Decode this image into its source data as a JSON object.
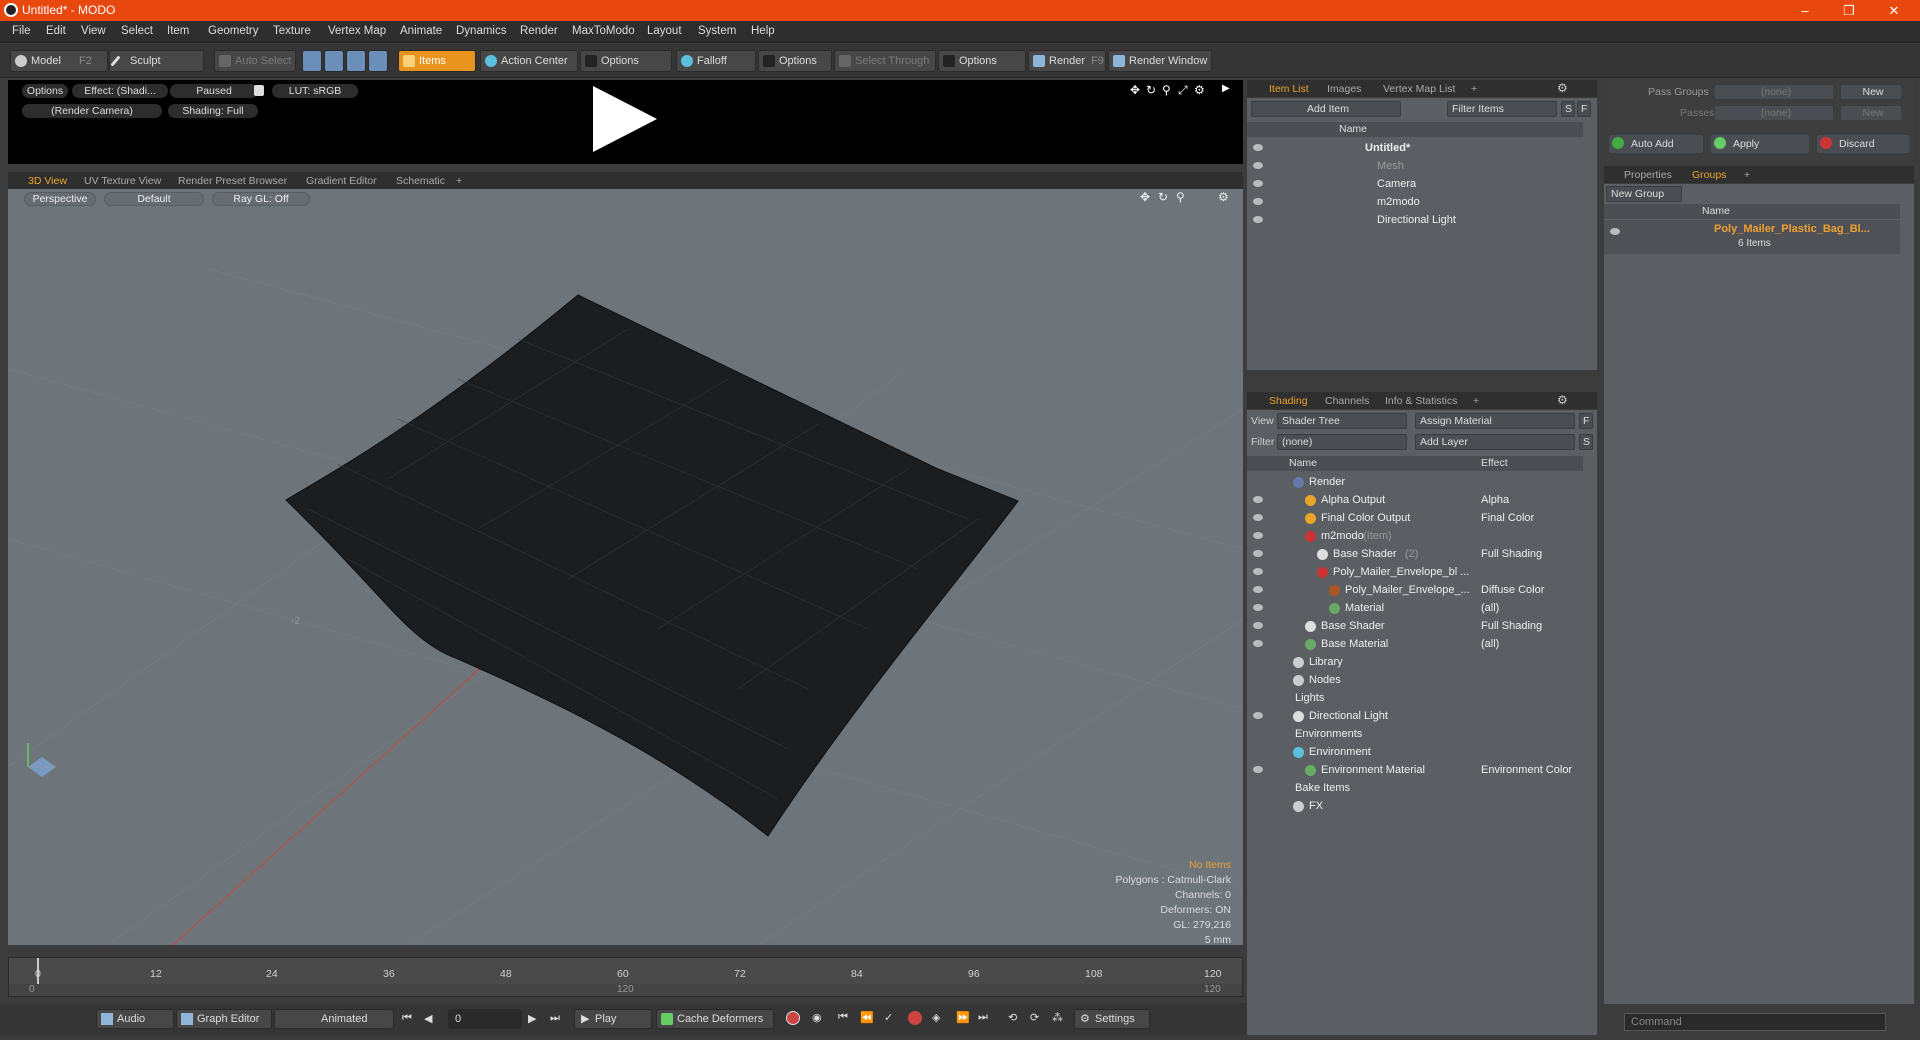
{
  "title": "Untitled* - MODO",
  "window_controls": [
    "–",
    "❐",
    "✕"
  ],
  "menu": [
    "File",
    "Edit",
    "View",
    "Select",
    "Item",
    "Geometry",
    "Texture",
    "Vertex Map",
    "Animate",
    "Dynamics",
    "Render",
    "MaxToModo",
    "Layout",
    "System",
    "Help"
  ],
  "toolbar": {
    "model": "Model",
    "model_key": "F2",
    "sculpt": "Sculpt",
    "auto_select": "Auto Select",
    "items": "Items",
    "action_center": "Action Center",
    "options1": "Options",
    "falloff": "Falloff",
    "options2": "Options",
    "select_through": "Select Through",
    "options3": "Options",
    "render": "Render",
    "render_key": "F9",
    "render_window": "Render Window"
  },
  "preview": {
    "options": "Options",
    "effect": "Effect: (Shadi...",
    "paused": "Paused",
    "lut": "LUT: sRGB",
    "camera": "(Render Camera)",
    "shading": "Shading: Full"
  },
  "viewport_tabs": [
    "3D View",
    "UV Texture View",
    "Render Preset Browser",
    "Gradient Editor",
    "Schematic",
    "+"
  ],
  "viewport": {
    "perspective": "Perspective",
    "default": "Default",
    "raygl": "Ray GL: Off",
    "axis_label": "-2",
    "info": {
      "no_items": "No Items",
      "polygons": "Polygons : Catmull-Clark",
      "channels": "Channels: 0",
      "deformers": "Deformers: ON",
      "gl": "GL: 279,216",
      "scale": "5 mm"
    }
  },
  "timeline": {
    "ticks": [
      "0",
      "12",
      "24",
      "36",
      "48",
      "60",
      "72",
      "84",
      "96",
      "108",
      "120"
    ],
    "bottom_ticks": [
      "0",
      "120",
      "120"
    ]
  },
  "bottombar": {
    "audio": "Audio",
    "graph_editor": "Graph Editor",
    "animated": "Animated",
    "frame": "0",
    "play": "Play",
    "cache": "Cache Deformers",
    "settings": "Settings"
  },
  "itemlist": {
    "tabs": [
      "Item List",
      "Images",
      "Vertex Map List",
      "+"
    ],
    "add_item": "Add Item",
    "filter": "Filter Items",
    "s": "S",
    "f": "F",
    "name_col": "Name",
    "rows": [
      {
        "name": "Untitled*"
      },
      {
        "name": "Mesh"
      },
      {
        "name": "Camera"
      },
      {
        "name": "m2modo"
      },
      {
        "name": "Directional Light"
      }
    ]
  },
  "shading": {
    "tabs": [
      "Shading",
      "Channels",
      "Info & Statistics",
      "+"
    ],
    "view_label": "View",
    "view_value": "Shader Tree",
    "assign": "Assign Material",
    "f": "F",
    "filter_label": "Filter",
    "filter_value": "(none)",
    "add_layer": "Add Layer",
    "s": "S",
    "name_col": "Name",
    "effect_col": "Effect",
    "rows": [
      {
        "name": "Render",
        "effect": ""
      },
      {
        "name": "Alpha Output",
        "effect": "Alpha"
      },
      {
        "name": "Final Color Output",
        "effect": "Final Color"
      },
      {
        "name": "m2modo",
        "suffix": "(Item)",
        "effect": ""
      },
      {
        "name": "Base Shader",
        "suffix": "(2)",
        "effect": "Full Shading"
      },
      {
        "name": "Poly_Mailer_Envelope_bl ...",
        "effect": ""
      },
      {
        "name": "Poly_Mailer_Envelope_...",
        "effect": "Diffuse Color"
      },
      {
        "name": "Material",
        "effect": "(all)"
      },
      {
        "name": "Base Shader",
        "effect": "Full Shading"
      },
      {
        "name": "Base Material",
        "effect": "(all)"
      },
      {
        "name": "Library",
        "effect": ""
      },
      {
        "name": "Nodes",
        "effect": ""
      },
      {
        "name": "Lights",
        "effect": ""
      },
      {
        "name": "Directional Light",
        "effect": ""
      },
      {
        "name": "Environments",
        "effect": ""
      },
      {
        "name": "Environment",
        "effect": ""
      },
      {
        "name": "Environment Material",
        "effect": "Environment Color"
      },
      {
        "name": "Bake Items",
        "effect": ""
      },
      {
        "name": "FX",
        "effect": ""
      }
    ]
  },
  "groups": {
    "pass_groups": "Pass Groups",
    "pass_groups_value": "(none)",
    "new1": "New",
    "passes": "Passes",
    "passes_value": "(none)",
    "new2": "New",
    "auto_add": "Auto Add",
    "apply": "Apply",
    "discard": "Discard",
    "tabs": [
      "Properties",
      "Groups",
      "+"
    ],
    "new_group": "New Group",
    "name_col": "Name",
    "group_name": "Poly_Mailer_Plastic_Bag_Bl...",
    "group_count": "6 Items"
  },
  "command_placeholder": "Command",
  "colors": {
    "accent": "#e9a42a",
    "titlebar": "#e8470e"
  }
}
